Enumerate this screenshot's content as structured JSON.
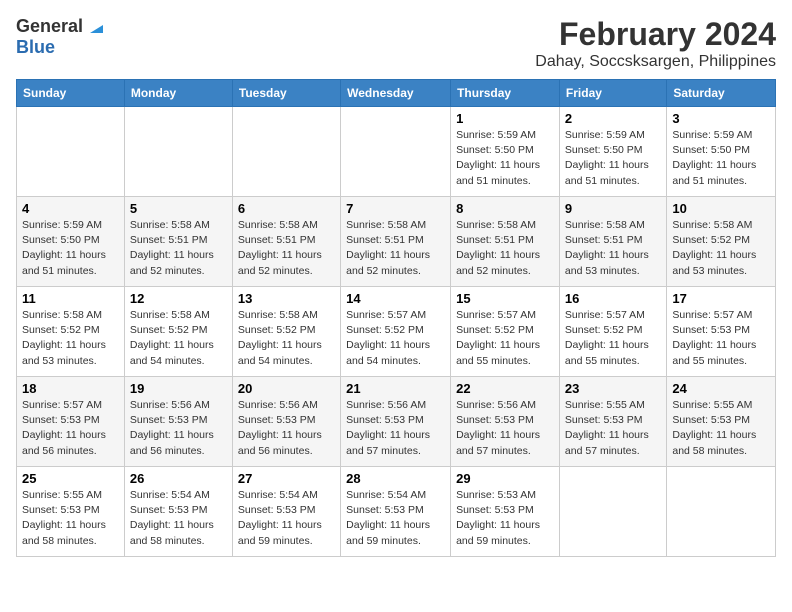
{
  "logo": {
    "general": "General",
    "blue": "Blue"
  },
  "title": {
    "main": "February 2024",
    "sub": "Dahay, Soccsksargen, Philippines"
  },
  "calendar": {
    "headers": [
      "Sunday",
      "Monday",
      "Tuesday",
      "Wednesday",
      "Thursday",
      "Friday",
      "Saturday"
    ],
    "weeks": [
      [
        {
          "day": "",
          "sunrise": "",
          "sunset": "",
          "daylight": ""
        },
        {
          "day": "",
          "sunrise": "",
          "sunset": "",
          "daylight": ""
        },
        {
          "day": "",
          "sunrise": "",
          "sunset": "",
          "daylight": ""
        },
        {
          "day": "",
          "sunrise": "",
          "sunset": "",
          "daylight": ""
        },
        {
          "day": "1",
          "sunrise": "Sunrise: 5:59 AM",
          "sunset": "Sunset: 5:50 PM",
          "daylight": "Daylight: 11 hours and 51 minutes."
        },
        {
          "day": "2",
          "sunrise": "Sunrise: 5:59 AM",
          "sunset": "Sunset: 5:50 PM",
          "daylight": "Daylight: 11 hours and 51 minutes."
        },
        {
          "day": "3",
          "sunrise": "Sunrise: 5:59 AM",
          "sunset": "Sunset: 5:50 PM",
          "daylight": "Daylight: 11 hours and 51 minutes."
        }
      ],
      [
        {
          "day": "4",
          "sunrise": "Sunrise: 5:59 AM",
          "sunset": "Sunset: 5:50 PM",
          "daylight": "Daylight: 11 hours and 51 minutes."
        },
        {
          "day": "5",
          "sunrise": "Sunrise: 5:58 AM",
          "sunset": "Sunset: 5:51 PM",
          "daylight": "Daylight: 11 hours and 52 minutes."
        },
        {
          "day": "6",
          "sunrise": "Sunrise: 5:58 AM",
          "sunset": "Sunset: 5:51 PM",
          "daylight": "Daylight: 11 hours and 52 minutes."
        },
        {
          "day": "7",
          "sunrise": "Sunrise: 5:58 AM",
          "sunset": "Sunset: 5:51 PM",
          "daylight": "Daylight: 11 hours and 52 minutes."
        },
        {
          "day": "8",
          "sunrise": "Sunrise: 5:58 AM",
          "sunset": "Sunset: 5:51 PM",
          "daylight": "Daylight: 11 hours and 52 minutes."
        },
        {
          "day": "9",
          "sunrise": "Sunrise: 5:58 AM",
          "sunset": "Sunset: 5:51 PM",
          "daylight": "Daylight: 11 hours and 53 minutes."
        },
        {
          "day": "10",
          "sunrise": "Sunrise: 5:58 AM",
          "sunset": "Sunset: 5:52 PM",
          "daylight": "Daylight: 11 hours and 53 minutes."
        }
      ],
      [
        {
          "day": "11",
          "sunrise": "Sunrise: 5:58 AM",
          "sunset": "Sunset: 5:52 PM",
          "daylight": "Daylight: 11 hours and 53 minutes."
        },
        {
          "day": "12",
          "sunrise": "Sunrise: 5:58 AM",
          "sunset": "Sunset: 5:52 PM",
          "daylight": "Daylight: 11 hours and 54 minutes."
        },
        {
          "day": "13",
          "sunrise": "Sunrise: 5:58 AM",
          "sunset": "Sunset: 5:52 PM",
          "daylight": "Daylight: 11 hours and 54 minutes."
        },
        {
          "day": "14",
          "sunrise": "Sunrise: 5:57 AM",
          "sunset": "Sunset: 5:52 PM",
          "daylight": "Daylight: 11 hours and 54 minutes."
        },
        {
          "day": "15",
          "sunrise": "Sunrise: 5:57 AM",
          "sunset": "Sunset: 5:52 PM",
          "daylight": "Daylight: 11 hours and 55 minutes."
        },
        {
          "day": "16",
          "sunrise": "Sunrise: 5:57 AM",
          "sunset": "Sunset: 5:52 PM",
          "daylight": "Daylight: 11 hours and 55 minutes."
        },
        {
          "day": "17",
          "sunrise": "Sunrise: 5:57 AM",
          "sunset": "Sunset: 5:53 PM",
          "daylight": "Daylight: 11 hours and 55 minutes."
        }
      ],
      [
        {
          "day": "18",
          "sunrise": "Sunrise: 5:57 AM",
          "sunset": "Sunset: 5:53 PM",
          "daylight": "Daylight: 11 hours and 56 minutes."
        },
        {
          "day": "19",
          "sunrise": "Sunrise: 5:56 AM",
          "sunset": "Sunset: 5:53 PM",
          "daylight": "Daylight: 11 hours and 56 minutes."
        },
        {
          "day": "20",
          "sunrise": "Sunrise: 5:56 AM",
          "sunset": "Sunset: 5:53 PM",
          "daylight": "Daylight: 11 hours and 56 minutes."
        },
        {
          "day": "21",
          "sunrise": "Sunrise: 5:56 AM",
          "sunset": "Sunset: 5:53 PM",
          "daylight": "Daylight: 11 hours and 57 minutes."
        },
        {
          "day": "22",
          "sunrise": "Sunrise: 5:56 AM",
          "sunset": "Sunset: 5:53 PM",
          "daylight": "Daylight: 11 hours and 57 minutes."
        },
        {
          "day": "23",
          "sunrise": "Sunrise: 5:55 AM",
          "sunset": "Sunset: 5:53 PM",
          "daylight": "Daylight: 11 hours and 57 minutes."
        },
        {
          "day": "24",
          "sunrise": "Sunrise: 5:55 AM",
          "sunset": "Sunset: 5:53 PM",
          "daylight": "Daylight: 11 hours and 58 minutes."
        }
      ],
      [
        {
          "day": "25",
          "sunrise": "Sunrise: 5:55 AM",
          "sunset": "Sunset: 5:53 PM",
          "daylight": "Daylight: 11 hours and 58 minutes."
        },
        {
          "day": "26",
          "sunrise": "Sunrise: 5:54 AM",
          "sunset": "Sunset: 5:53 PM",
          "daylight": "Daylight: 11 hours and 58 minutes."
        },
        {
          "day": "27",
          "sunrise": "Sunrise: 5:54 AM",
          "sunset": "Sunset: 5:53 PM",
          "daylight": "Daylight: 11 hours and 59 minutes."
        },
        {
          "day": "28",
          "sunrise": "Sunrise: 5:54 AM",
          "sunset": "Sunset: 5:53 PM",
          "daylight": "Daylight: 11 hours and 59 minutes."
        },
        {
          "day": "29",
          "sunrise": "Sunrise: 5:53 AM",
          "sunset": "Sunset: 5:53 PM",
          "daylight": "Daylight: 11 hours and 59 minutes."
        },
        {
          "day": "",
          "sunrise": "",
          "sunset": "",
          "daylight": ""
        },
        {
          "day": "",
          "sunrise": "",
          "sunset": "",
          "daylight": ""
        }
      ]
    ]
  }
}
